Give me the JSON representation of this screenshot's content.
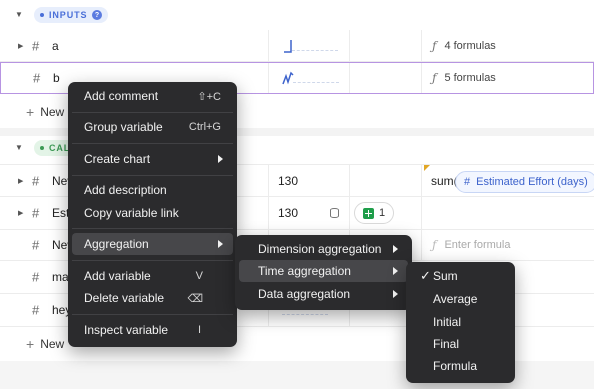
{
  "inputs_section": {
    "label": "INPUTS",
    "help": "?"
  },
  "calc_section": {
    "label": "CAL"
  },
  "inputs_rows": [
    {
      "name": "a",
      "formula_count": "4 formulas"
    },
    {
      "name": "b",
      "formula_count": "5 formulas"
    }
  ],
  "new_label": "New",
  "new_label_bottom": "New",
  "calc_rows": [
    {
      "name": "New",
      "value": "130",
      "formula_prefix": "sum(",
      "formula_var": "Estimated Effort (days)"
    },
    {
      "name": "Est",
      "value": "130",
      "sheet_count": "1"
    },
    {
      "name": "New",
      "formula_placeholder": "Enter formula"
    },
    {
      "name": "ma"
    },
    {
      "name": "hey"
    }
  ],
  "icons": {
    "fx": "ƒ",
    "hash": "#",
    "var_hash": "#"
  },
  "context_menu": {
    "add_comment": "Add comment",
    "add_comment_sc": "⇧+C",
    "group_variable": "Group variable",
    "group_variable_sc": "Ctrl+G",
    "create_chart": "Create chart",
    "add_description": "Add description",
    "copy_link": "Copy variable link",
    "aggregation": "Aggregation",
    "add_variable": "Add variable",
    "add_variable_sc": "V",
    "delete_variable": "Delete variable",
    "delete_variable_sc": "⌫",
    "inspect_variable": "Inspect variable",
    "inspect_variable_sc": "I"
  },
  "aggregation_menu": {
    "dimension": "Dimension aggregation",
    "time": "Time aggregation",
    "data": "Data aggregation"
  },
  "time_menu": {
    "selected_check": "✓",
    "items": [
      "Sum",
      "Average",
      "Initial",
      "Final",
      "Formula"
    ]
  },
  "colors": {
    "menu_bg": "#2b2b2d",
    "accent_blue": "#4a6fd8",
    "accent_green": "#3c9a55",
    "selection": "#b794e2"
  }
}
